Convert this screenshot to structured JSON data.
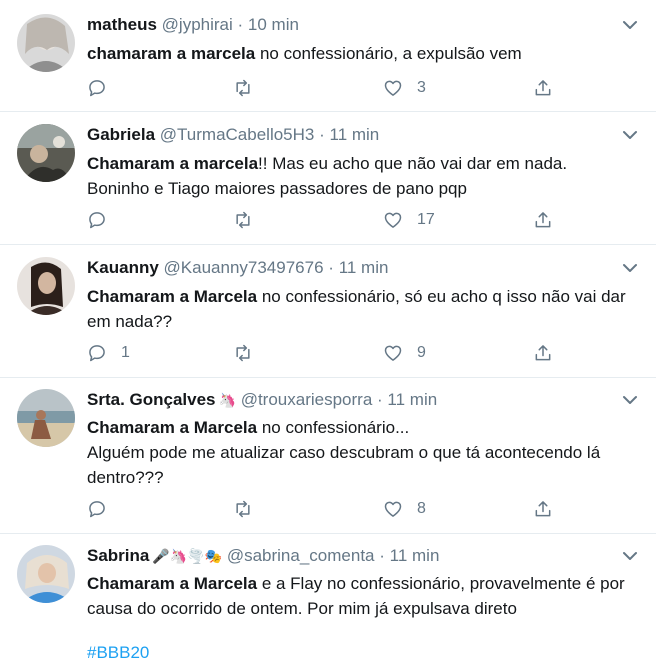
{
  "tweets": [
    {
      "name": "matheus",
      "emojis": "",
      "handle": "@jyphirai",
      "sep": "·",
      "time": "10 min",
      "bold": "chamaram a marcela",
      "text": " no confessionário, a expulsão vem",
      "replies": "",
      "retweets": "",
      "likes": "3"
    },
    {
      "name": "Gabriela",
      "emojis": "",
      "handle": "@TurmaCabello5H3",
      "sep": "·",
      "time": "11 min",
      "bold": "Chamaram a marcela",
      "text": "!! Mas eu acho que não vai dar em nada. Boninho e Tiago maiores passadores de pano pqp",
      "replies": "",
      "retweets": "",
      "likes": "17"
    },
    {
      "name": "Kauanny",
      "emojis": "",
      "handle": "@Kauanny73497676",
      "sep": "·",
      "time": "11 min",
      "bold": "Chamaram a Marcela",
      "text": " no confessionário, só eu acho q isso não vai dar em nada??",
      "replies": "1",
      "retweets": "",
      "likes": "9"
    },
    {
      "name": "Srta. Gonçalves",
      "emojis": "🦄",
      "handle": "@trouxariesporra",
      "sep": "·",
      "time": "11 min",
      "bold": "Chamaram a Marcela",
      "text": " no confessionário...",
      "line2": "Alguém pode me atualizar caso descubram o que tá acontecendo lá dentro???",
      "replies": "",
      "retweets": "",
      "likes": "8"
    },
    {
      "name": "Sabrina",
      "emojis": "🎤🦄🌪️🎭",
      "handle": "@sabrina_comenta",
      "sep": "·",
      "time": "11 min",
      "bold": "Chamaram a Marcela",
      "text": " e a Flay no confessionário, provavelmente é por causa do ocorrido de ontem. Por mim já expulsava direto",
      "hashtag": "#BBB20"
    }
  ],
  "colors": {
    "text": "#14171a",
    "muted": "#657786",
    "link": "#1da1f2",
    "divider": "#e6ecf0"
  },
  "icons": [
    "reply-icon",
    "retweet-icon",
    "like-icon",
    "share-icon",
    "chevron-down-icon"
  ]
}
